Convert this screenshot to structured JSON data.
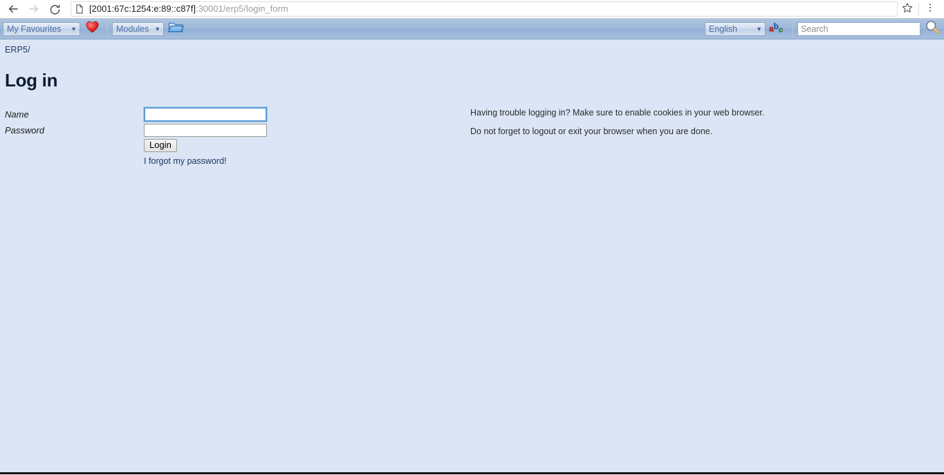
{
  "browser": {
    "back_icon": "back-arrow-icon",
    "forward_icon": "forward-arrow-icon",
    "reload_icon": "reload-icon",
    "page_icon": "page-document-icon",
    "url_host": "[2001:67c:1254:e:89::c87f]",
    "url_path": ":30001/erp5/login_form",
    "url_full": "[2001:67c:1254:e:89::c87f]:30001/erp5/login_form",
    "star_icon": "bookmark-star-icon",
    "menu_icon": "three-dot-menu-icon"
  },
  "toolbar": {
    "favourites_label": "My Favourites",
    "favourites_caret": "▼",
    "heart_icon": "heart-icon",
    "modules_label": "Modules",
    "modules_caret": "▼",
    "folder_icon": "open-folder-icon",
    "language_label": "English",
    "language_caret": "▼",
    "translate_icon": "abc-translate-icon",
    "search_placeholder": "Search",
    "search_value": "",
    "search_icon": "magnifier-search-icon"
  },
  "breadcrumb": {
    "root": "ERP5",
    "separator": "/"
  },
  "main": {
    "title": "Log in",
    "fields": [
      {
        "label": "Name",
        "value": "",
        "type": "text"
      },
      {
        "label": "Password",
        "value": "",
        "type": "password"
      }
    ],
    "login_button": "Login",
    "forgot_link": "I forgot my password!",
    "help_lines": [
      "Having trouble logging in? Make sure to enable cookies in your web browser.",
      "Do not forget to logout or exit your browser when you are done."
    ]
  },
  "colors": {
    "page_background": "#dbe5f5",
    "toolbar_background": "#9db8da",
    "title_color": "#0d1b33",
    "link_color": "#1f3864",
    "focus_border": "#5b9bd5"
  }
}
